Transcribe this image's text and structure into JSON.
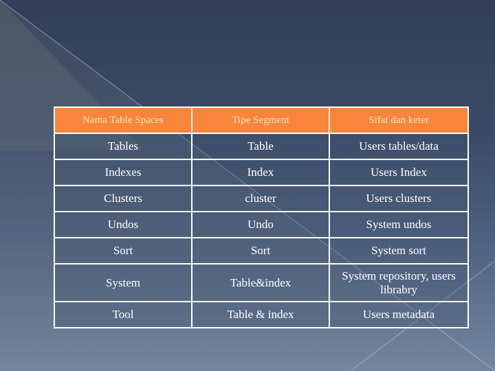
{
  "theme": {
    "header_bg": "#f9853a",
    "header_text": "#fbe6c8",
    "body_text": "#ffffff",
    "border": "#ffffff",
    "background_top": "#333f57",
    "background_bottom": "#7486a1"
  },
  "table": {
    "headers": [
      "Nama Table Spaces",
      "Tipe Segment",
      "Sifat dan keter"
    ],
    "rows": [
      [
        "Tables",
        "Table",
        "Users tables/data"
      ],
      [
        "Indexes",
        "Index",
        "Users Index"
      ],
      [
        "Clusters",
        "cluster",
        "Users clusters"
      ],
      [
        "Undos",
        "Undo",
        "System undos"
      ],
      [
        "Sort",
        "Sort",
        "System sort"
      ],
      [
        "System",
        "Table&index",
        "System repository, users librabry"
      ],
      [
        "Tool",
        "Table & index",
        "Users metadata"
      ]
    ]
  }
}
